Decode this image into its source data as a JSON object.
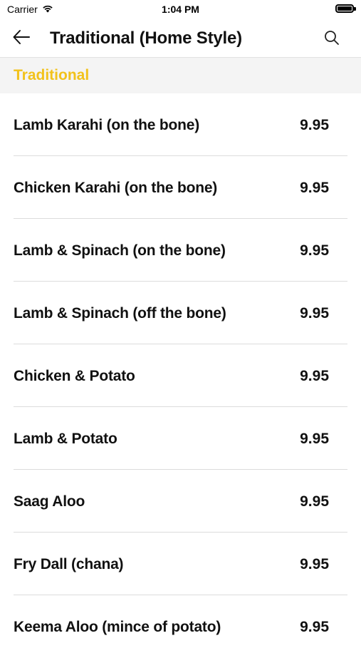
{
  "status_bar": {
    "carrier": "Carrier",
    "time": "1:04 PM"
  },
  "nav": {
    "title": "Traditional (Home Style)"
  },
  "section": {
    "title": "Traditional"
  },
  "items": [
    {
      "name": "Lamb Karahi (on the bone)",
      "price": "9.95"
    },
    {
      "name": "Chicken Karahi (on the bone)",
      "price": "9.95"
    },
    {
      "name": "Lamb & Spinach (on the bone)",
      "price": "9.95"
    },
    {
      "name": "Lamb & Spinach (off the bone)",
      "price": "9.95"
    },
    {
      "name": "Chicken & Potato",
      "price": "9.95"
    },
    {
      "name": "Lamb & Potato",
      "price": "9.95"
    },
    {
      "name": "Saag Aloo",
      "price": "9.95"
    },
    {
      "name": "Fry Dall (chana)",
      "price": "9.95"
    },
    {
      "name": "Keema Aloo (mince of potato)",
      "price": "9.95"
    }
  ],
  "colors": {
    "accent": "#f2c21b",
    "section_bg": "#f4f4f4",
    "divider": "#dcdcdc"
  },
  "icons": {
    "back": "arrow-left-icon",
    "search": "search-icon",
    "wifi": "wifi-icon",
    "battery": "battery-icon"
  }
}
